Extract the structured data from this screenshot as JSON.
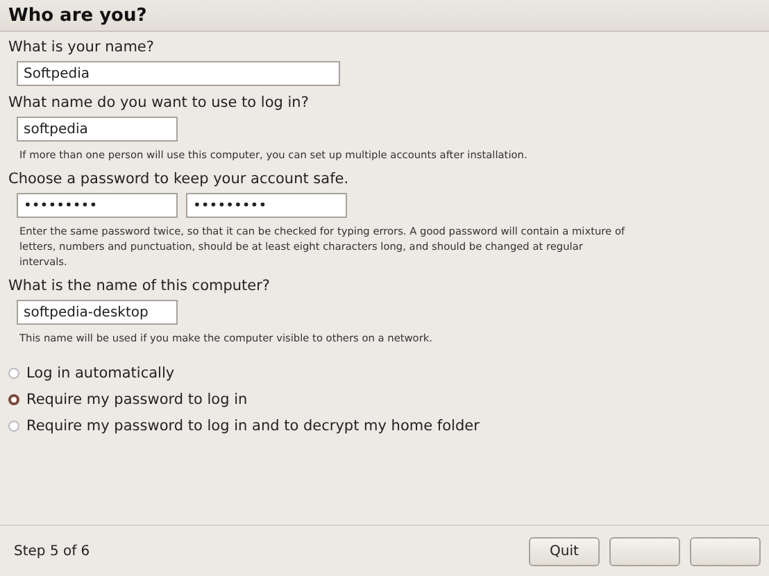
{
  "title": "Who are you?",
  "sections": [
    {
      "label": "What is your name?",
      "fields": [
        {
          "value": "Softpedia",
          "kind": "wide"
        }
      ]
    },
    {
      "label": "What name do you want to use to log in?",
      "fields": [
        {
          "value": "softpedia",
          "kind": "narrow"
        }
      ],
      "hint": "If more than one person will use this computer, you can set up multiple accounts after installation."
    },
    {
      "label": "Choose a password to keep your account safe.",
      "fields": [
        {
          "value": "•••••••••",
          "kind": "narrow"
        },
        {
          "value": "•••••••••",
          "kind": "narrow"
        }
      ],
      "hint": "Enter the same password twice, so that it can be checked for typing errors. A good password will contain a mixture of letters, numbers and punctuation, should be at least eight characters long, and should be changed at regular intervals."
    },
    {
      "label": "What is the name of this computer?",
      "fields": [
        {
          "value": "softpedia-desktop",
          "kind": "narrow"
        }
      ],
      "hint": "This name will be used if you make the computer visible to others on a network."
    }
  ],
  "login_options": [
    {
      "label": "Log in automatically",
      "selected": false
    },
    {
      "label": "Require my password to log in",
      "selected": true
    },
    {
      "label": "Require my password to log in and to decrypt my home folder",
      "selected": false
    }
  ],
  "footer": {
    "step": "Step 5 of 6",
    "buttons": [
      {
        "kind": "text",
        "label": "Quit"
      },
      {
        "kind": "blank"
      },
      {
        "kind": "blank"
      }
    ]
  }
}
